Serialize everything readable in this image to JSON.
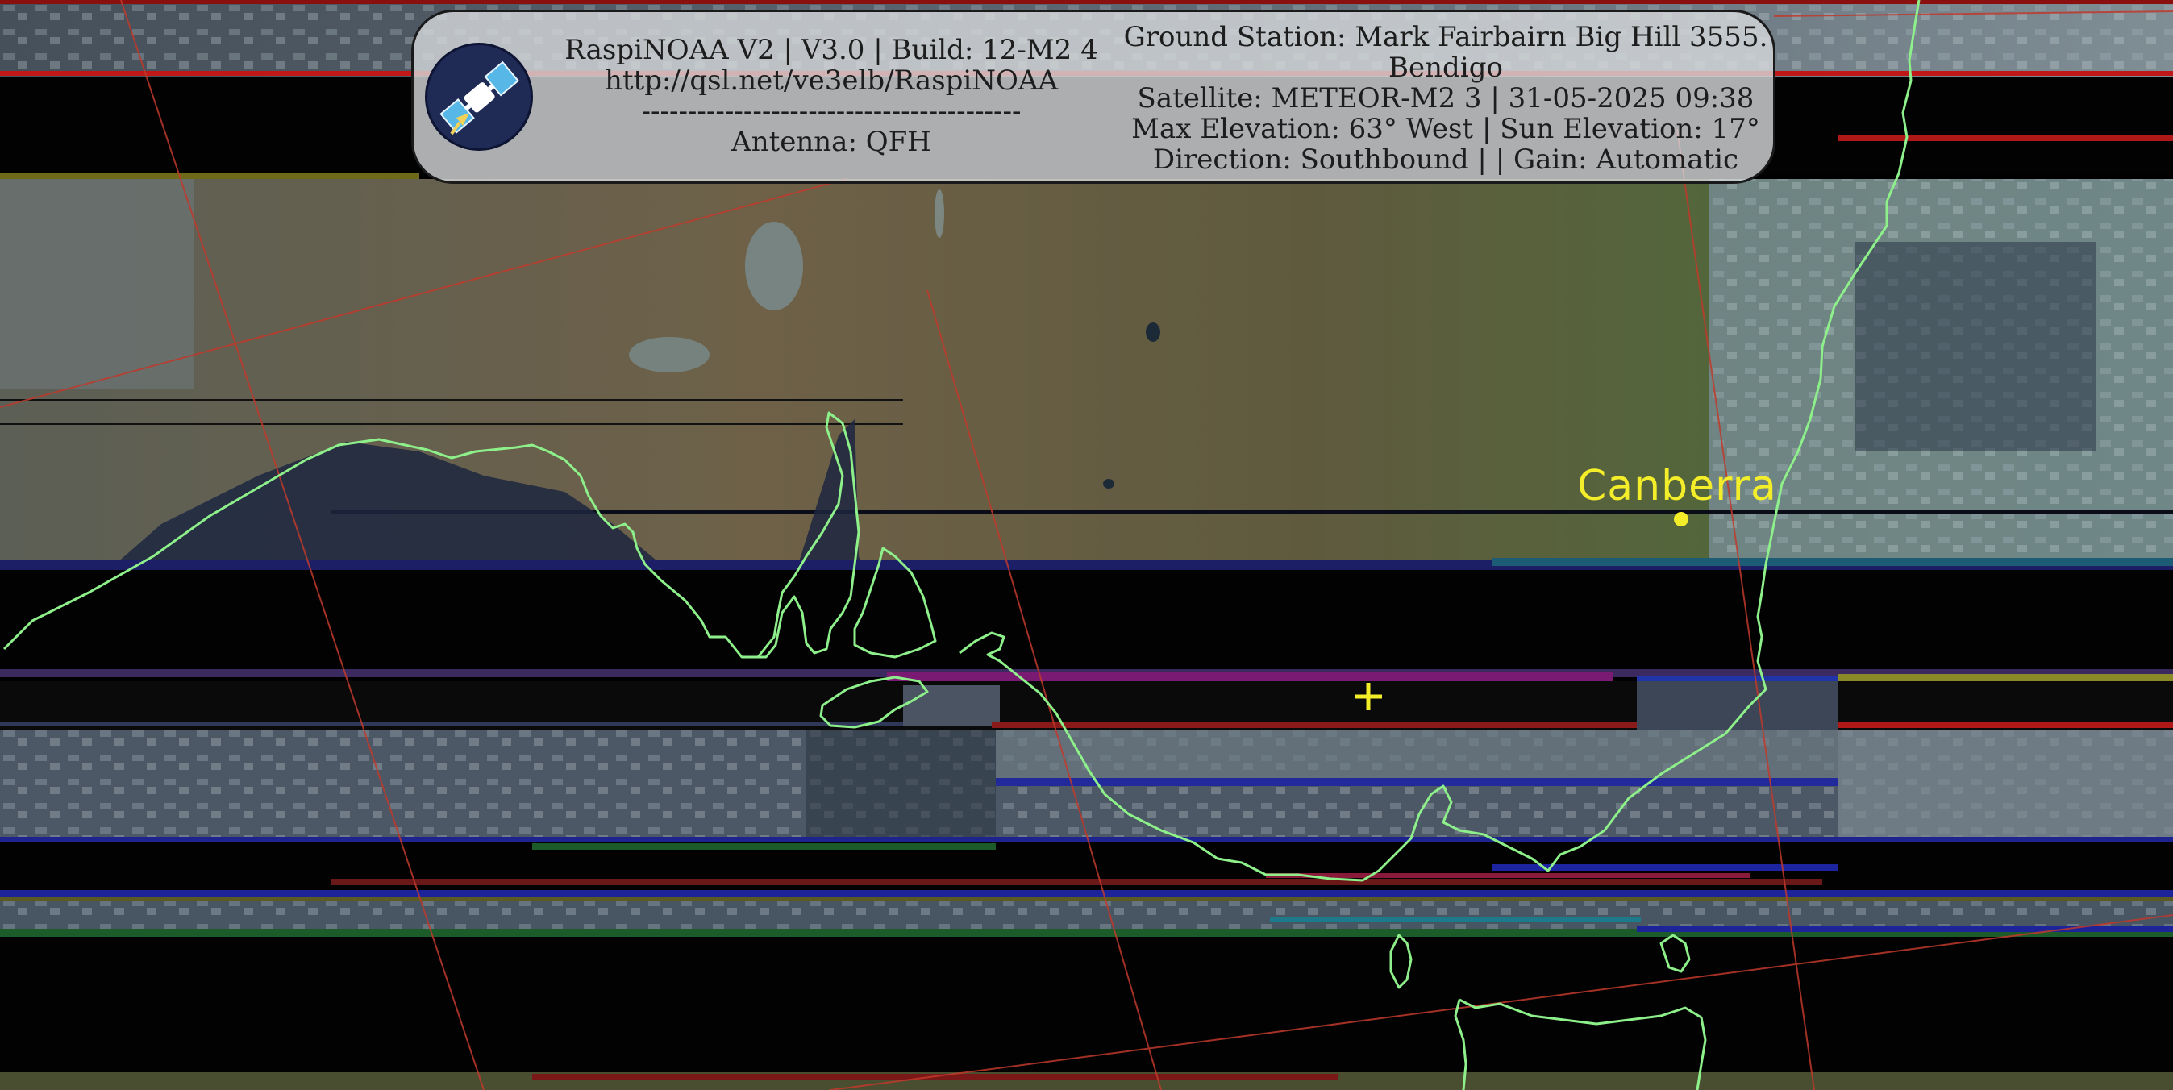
{
  "overlay": {
    "left_lines": [
      "RaspiNOAA V2 | V3.0 | Build: 12-M2 4",
      "http://qsl.net/ve3elb/RaspiNOAA",
      "-----------------------------------------",
      "Antenna: QFH"
    ],
    "right_lines": [
      "Ground Station: Mark Fairbairn Big Hill 3555.",
      "Bendigo",
      "Satellite: METEOR-M2 3 | 31-05-2025 09:38",
      "Max Elevation: 63° West | Sun Elevation: 17°",
      "Direction: Southbound | | Gain: Automatic"
    ],
    "logo_icon": "satellite-icon"
  },
  "map": {
    "city_label": "Canberra",
    "marker_icon": "crosshair-icon",
    "colors": {
      "coastline": "#8ef08a",
      "gridlines": "#c0392b",
      "city": "#f4ee2a",
      "land": "#6b6346",
      "sea": "#1e2838"
    }
  }
}
